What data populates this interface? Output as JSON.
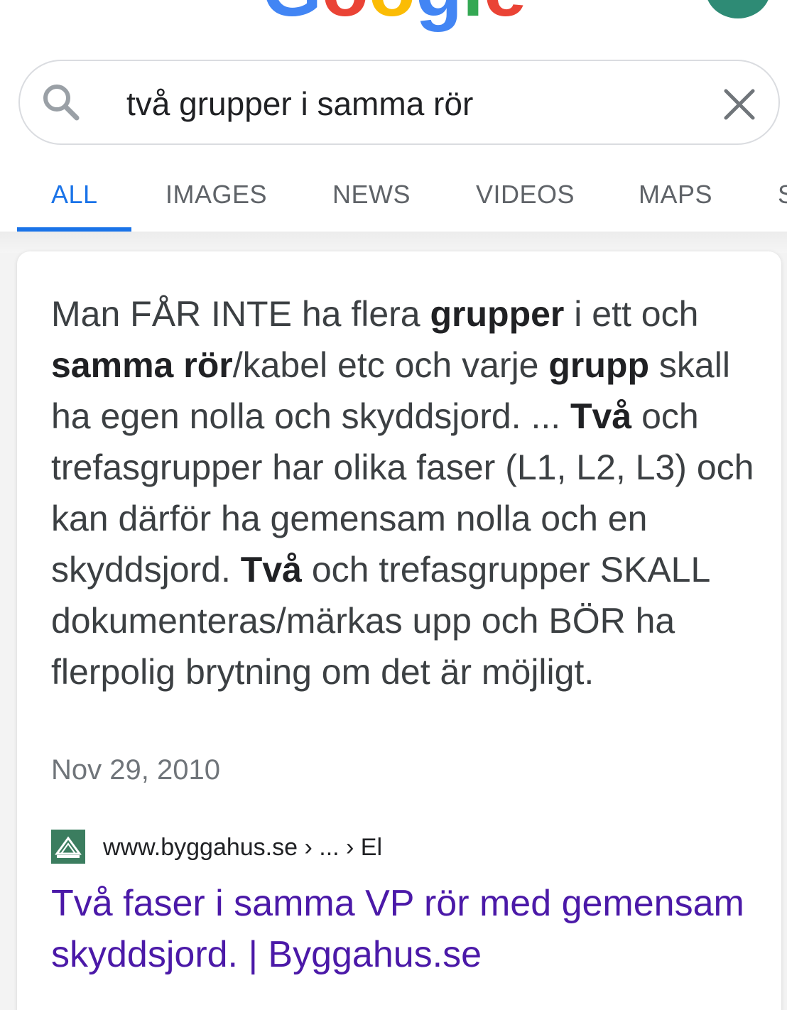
{
  "header": {
    "logo_text": "Google",
    "logo_colors": [
      "#4285F4",
      "#EA4335",
      "#FBBC05",
      "#4285F4",
      "#34A853",
      "#EA4335"
    ],
    "avatar_color": "#2e8b75"
  },
  "search": {
    "query": "två grupper i samma rör",
    "icon": "search-icon",
    "clear_icon": "close-icon"
  },
  "tabs": [
    {
      "label": "ALL",
      "active": true
    },
    {
      "label": "IMAGES",
      "active": false
    },
    {
      "label": "NEWS",
      "active": false
    },
    {
      "label": "VIDEOS",
      "active": false
    },
    {
      "label": "MAPS",
      "active": false
    },
    {
      "label": "S",
      "active": false
    }
  ],
  "featured_snippet": {
    "parts": [
      {
        "text": "Man FÅR INTE ha flera ",
        "bold": false
      },
      {
        "text": "grupper",
        "bold": true
      },
      {
        "text": " i ett och ",
        "bold": false
      },
      {
        "text": "samma rör",
        "bold": true
      },
      {
        "text": "/kabel etc och varje ",
        "bold": false
      },
      {
        "text": "grupp",
        "bold": true
      },
      {
        "text": " skall ha egen nolla och skyddsjord. ... ",
        "bold": false
      },
      {
        "text": "Två",
        "bold": true
      },
      {
        "text": " och trefasgrupper har olika faser (L1, L2, L3) och kan därför ha gemensam nolla och en skyddsjord. ",
        "bold": false
      },
      {
        "text": "Två",
        "bold": true
      },
      {
        "text": " och trefasgrupper SKALL dokumenteras/märkas upp och BÖR ha flerpolig brytning om det är möjligt.",
        "bold": false
      }
    ],
    "date": "Nov 29, 2010",
    "source_url": "www.byggahus.se › ... › El",
    "favicon_color": "#3b7d5f",
    "title": "Två faser i samma VP rör med gemensam skyddsjord. | Byggahus.se",
    "title_color": "#4b19a8"
  }
}
